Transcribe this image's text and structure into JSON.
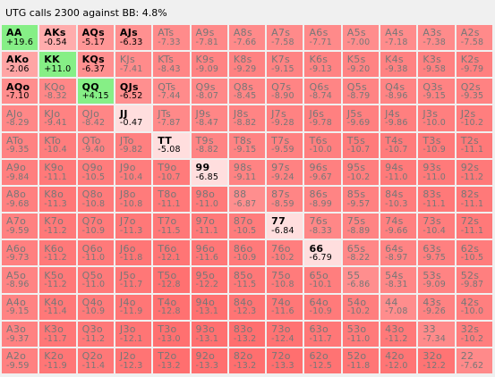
{
  "title": "UTG calls 2300 against BB: 4.8%",
  "colors": {
    "green": "#86ef86",
    "salmon": "#ff9e9e",
    "highlight": "#ffdede",
    "muted_text": "#777777"
  },
  "rows": [
    [
      [
        "AA",
        "+19.6",
        "green"
      ],
      [
        "AKs",
        "-0.54",
        "salmon"
      ],
      [
        "AQs",
        "-5.17",
        "salmon"
      ],
      [
        "AJs",
        "-6.33",
        "salmon"
      ],
      [
        "ATs",
        "-7.33",
        "muted"
      ],
      [
        "A9s",
        "-7.81",
        "muted"
      ],
      [
        "A8s",
        "-7.66",
        "muted"
      ],
      [
        "A7s",
        "-7.58",
        "muted"
      ],
      [
        "A6s",
        "-7.71",
        "muted"
      ],
      [
        "A5s",
        "-7.00",
        "muted"
      ],
      [
        "A4s",
        "-7.18",
        "muted"
      ],
      [
        "A3s",
        "-7.38",
        "muted"
      ],
      [
        "A2s",
        "-7.58",
        "muted"
      ]
    ],
    [
      [
        "AKo",
        "-2.06",
        "salmon"
      ],
      [
        "KK",
        "+11.0",
        "green"
      ],
      [
        "KQs",
        "-6.37",
        "salmon"
      ],
      [
        "KJs",
        "-7.41",
        "muted"
      ],
      [
        "KTs",
        "-8.43",
        "muted"
      ],
      [
        "K9s",
        "-9.09",
        "muted"
      ],
      [
        "K8s",
        "-9.29",
        "muted"
      ],
      [
        "K7s",
        "-9.15",
        "muted"
      ],
      [
        "K6s",
        "-9.13",
        "muted"
      ],
      [
        "K5s",
        "-9.20",
        "muted"
      ],
      [
        "K4s",
        "-9.38",
        "muted"
      ],
      [
        "K3s",
        "-9.58",
        "muted"
      ],
      [
        "K2s",
        "-9.79",
        "muted"
      ]
    ],
    [
      [
        "AQo",
        "-7.10",
        "salmon"
      ],
      [
        "KQo",
        "-8.32",
        "muted"
      ],
      [
        "QQ",
        "+4.15",
        "green"
      ],
      [
        "QJs",
        "-6.52",
        "salmon"
      ],
      [
        "QTs",
        "-7.44",
        "muted"
      ],
      [
        "Q9s",
        "-8.07",
        "muted"
      ],
      [
        "Q8s",
        "-8.45",
        "muted"
      ],
      [
        "Q7s",
        "-8.90",
        "muted"
      ],
      [
        "Q6s",
        "-8.74",
        "muted"
      ],
      [
        "Q5s",
        "-8.79",
        "muted"
      ],
      [
        "Q4s",
        "-8.96",
        "muted"
      ],
      [
        "Q3s",
        "-9.15",
        "muted"
      ],
      [
        "Q2s",
        "-9.35",
        "muted"
      ]
    ],
    [
      [
        "AJo",
        "-8.29",
        "muted"
      ],
      [
        "KJo",
        "-9.41",
        "muted"
      ],
      [
        "QJo",
        "-8.42",
        "muted"
      ],
      [
        "JJ",
        "-0.47",
        "highlight"
      ],
      [
        "JTs",
        "-7.87",
        "muted"
      ],
      [
        "J9s",
        "-8.47",
        "muted"
      ],
      [
        "J8s",
        "-8.82",
        "muted"
      ],
      [
        "J7s",
        "-9.28",
        "muted"
      ],
      [
        "J6s",
        "-9.78",
        "muted"
      ],
      [
        "J5s",
        "-9.69",
        "muted"
      ],
      [
        "J4s",
        "-9.86",
        "muted"
      ],
      [
        "J3s",
        "-10.0",
        "muted"
      ],
      [
        "J2s",
        "-10.2",
        "muted"
      ]
    ],
    [
      [
        "ATo",
        "-9.35",
        "muted"
      ],
      [
        "KTo",
        "-10.4",
        "muted"
      ],
      [
        "QTo",
        "-9.40",
        "muted"
      ],
      [
        "JTo",
        "-9.82",
        "muted"
      ],
      [
        "TT",
        "-5.08",
        "highlight"
      ],
      [
        "T9s",
        "-8.82",
        "muted"
      ],
      [
        "T8s",
        "-9.15",
        "muted"
      ],
      [
        "T7s",
        "-9.59",
        "muted"
      ],
      [
        "T6s",
        "-10.0",
        "muted"
      ],
      [
        "T5s",
        "-10.7",
        "muted"
      ],
      [
        "T4s",
        "-10.7",
        "muted"
      ],
      [
        "T3s",
        "-10.9",
        "muted"
      ],
      [
        "T2s",
        "-11.1",
        "muted"
      ]
    ],
    [
      [
        "A9o",
        "-9.84",
        "muted"
      ],
      [
        "K9o",
        "-11.1",
        "muted"
      ],
      [
        "Q9o",
        "-10.5",
        "muted"
      ],
      [
        "J9o",
        "-10.4",
        "muted"
      ],
      [
        "T9o",
        "-10.7",
        "muted"
      ],
      [
        "99",
        "-6.85",
        "highlight"
      ],
      [
        "98s",
        "-9.11",
        "muted"
      ],
      [
        "97s",
        "-9.24",
        "muted"
      ],
      [
        "96s",
        "-9.67",
        "muted"
      ],
      [
        "95s",
        "-10.2",
        "muted"
      ],
      [
        "94s",
        "-11.0",
        "muted"
      ],
      [
        "93s",
        "-11.0",
        "muted"
      ],
      [
        "92s",
        "-11.2",
        "muted"
      ]
    ],
    [
      [
        "A8o",
        "-9.68",
        "muted"
      ],
      [
        "K8o",
        "-11.3",
        "muted"
      ],
      [
        "Q8o",
        "-10.8",
        "muted"
      ],
      [
        "J8o",
        "-10.8",
        "muted"
      ],
      [
        "T8o",
        "-11.1",
        "muted"
      ],
      [
        "98o",
        "-11.0",
        "muted"
      ],
      [
        "88",
        "-6.87",
        "muted"
      ],
      [
        "87s",
        "-8.59",
        "muted"
      ],
      [
        "86s",
        "-8.99",
        "muted"
      ],
      [
        "85s",
        "-9.57",
        "muted"
      ],
      [
        "84s",
        "-10.3",
        "muted"
      ],
      [
        "83s",
        "-11.1",
        "muted"
      ],
      [
        "82s",
        "-11.1",
        "muted"
      ]
    ],
    [
      [
        "A7o",
        "-9.59",
        "muted"
      ],
      [
        "K7o",
        "-11.2",
        "muted"
      ],
      [
        "Q7o",
        "-10.9",
        "muted"
      ],
      [
        "J7o",
        "-11.3",
        "muted"
      ],
      [
        "T7o",
        "-11.5",
        "muted"
      ],
      [
        "97o",
        "-11.1",
        "muted"
      ],
      [
        "87o",
        "-10.5",
        "muted"
      ],
      [
        "77",
        "-6.84",
        "highlight"
      ],
      [
        "76s",
        "-8.33",
        "muted"
      ],
      [
        "75s",
        "-8.89",
        "muted"
      ],
      [
        "74s",
        "-9.66",
        "muted"
      ],
      [
        "73s",
        "-10.4",
        "muted"
      ],
      [
        "72s",
        "-11.1",
        "muted"
      ]
    ],
    [
      [
        "A6o",
        "-9.73",
        "muted"
      ],
      [
        "K6o",
        "-11.2",
        "muted"
      ],
      [
        "Q6o",
        "-11.0",
        "muted"
      ],
      [
        "J6o",
        "-11.8",
        "muted"
      ],
      [
        "T6o",
        "-12.1",
        "muted"
      ],
      [
        "96o",
        "-11.6",
        "muted"
      ],
      [
        "86o",
        "-10.9",
        "muted"
      ],
      [
        "76o",
        "-10.2",
        "muted"
      ],
      [
        "66",
        "-6.79",
        "highlight"
      ],
      [
        "65s",
        "-8.22",
        "muted"
      ],
      [
        "64s",
        "-8.97",
        "muted"
      ],
      [
        "63s",
        "-9.75",
        "muted"
      ],
      [
        "62s",
        "-10.5",
        "muted"
      ]
    ],
    [
      [
        "A5o",
        "-8.96",
        "muted"
      ],
      [
        "K5o",
        "-11.2",
        "muted"
      ],
      [
        "Q5o",
        "-11.0",
        "muted"
      ],
      [
        "J5o",
        "-11.7",
        "muted"
      ],
      [
        "T5o",
        "-12.8",
        "muted"
      ],
      [
        "95o",
        "-12.2",
        "muted"
      ],
      [
        "85o",
        "-11.5",
        "muted"
      ],
      [
        "75o",
        "-10.8",
        "muted"
      ],
      [
        "65o",
        "-10.1",
        "muted"
      ],
      [
        "55",
        "-6.86",
        "muted"
      ],
      [
        "54s",
        "-8.31",
        "muted"
      ],
      [
        "53s",
        "-9.09",
        "muted"
      ],
      [
        "52s",
        "-9.87",
        "muted"
      ]
    ],
    [
      [
        "A4o",
        "-9.15",
        "muted"
      ],
      [
        "K4o",
        "-11.4",
        "muted"
      ],
      [
        "Q4o",
        "-10.9",
        "muted"
      ],
      [
        "J4o",
        "-11.9",
        "muted"
      ],
      [
        "T4o",
        "-12.8",
        "muted"
      ],
      [
        "94o",
        "-13.1",
        "muted"
      ],
      [
        "84o",
        "-12.3",
        "muted"
      ],
      [
        "74o",
        "-11.6",
        "muted"
      ],
      [
        "64o",
        "-10.9",
        "muted"
      ],
      [
        "54o",
        "-10.2",
        "muted"
      ],
      [
        "44",
        "-7.08",
        "muted"
      ],
      [
        "43s",
        "-9.26",
        "muted"
      ],
      [
        "42s",
        "-10.0",
        "muted"
      ]
    ],
    [
      [
        "A3o",
        "-9.37",
        "muted"
      ],
      [
        "K3o",
        "-11.7",
        "muted"
      ],
      [
        "Q3o",
        "-11.2",
        "muted"
      ],
      [
        "J3o",
        "-12.1",
        "muted"
      ],
      [
        "T3o",
        "-13.0",
        "muted"
      ],
      [
        "93o",
        "-13.1",
        "muted"
      ],
      [
        "83o",
        "-13.2",
        "muted"
      ],
      [
        "73o",
        "-12.4",
        "muted"
      ],
      [
        "63o",
        "-11.7",
        "muted"
      ],
      [
        "53o",
        "-11.0",
        "muted"
      ],
      [
        "43o",
        "-11.2",
        "muted"
      ],
      [
        "33",
        "-7.34",
        "muted"
      ],
      [
        "32s",
        "-10.2",
        "muted"
      ]
    ],
    [
      [
        "A2o",
        "-9.59",
        "muted"
      ],
      [
        "K2o",
        "-11.9",
        "muted"
      ],
      [
        "Q2o",
        "-11.4",
        "muted"
      ],
      [
        "J2o",
        "-12.3",
        "muted"
      ],
      [
        "T2o",
        "-13.2",
        "muted"
      ],
      [
        "92o",
        "-13.3",
        "muted"
      ],
      [
        "82o",
        "-13.2",
        "muted"
      ],
      [
        "72o",
        "-13.3",
        "muted"
      ],
      [
        "62o",
        "-12.5",
        "muted"
      ],
      [
        "52o",
        "-11.8",
        "muted"
      ],
      [
        "42o",
        "-12.0",
        "muted"
      ],
      [
        "32o",
        "-12.2",
        "muted"
      ],
      [
        "22",
        "-7.62",
        "muted"
      ]
    ]
  ]
}
